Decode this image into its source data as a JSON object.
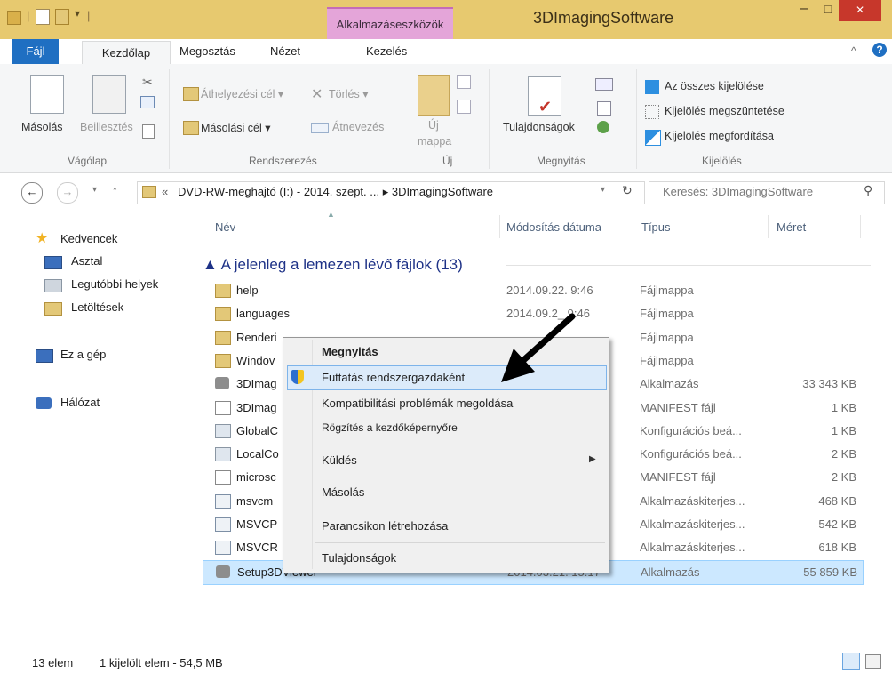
{
  "window": {
    "title": "3DImagingSoftware",
    "context_tab_group": "Alkalmazáseszközök",
    "controls": [
      "–",
      "□",
      "×"
    ]
  },
  "ribbon_tabs": [
    "Fájl",
    "Kezdőlap",
    "Megosztás",
    "Nézet",
    "Kezelés"
  ],
  "ribbon": {
    "clipboard": {
      "copy": "Másolás",
      "paste": "Beillesztés",
      "label": "Vágólap"
    },
    "organize": {
      "move_to": "Áthelyezési cél ▾",
      "copy_to": "Másolási cél ▾",
      "delete": "Törlés ▾",
      "rename": "Átnevezés",
      "label": "Rendszerezés"
    },
    "new": {
      "new_folder_1": "Új",
      "new_folder_2": "mappa",
      "label": "Új"
    },
    "open": {
      "properties": "Tulajdonságok",
      "label": "Megnyitás"
    },
    "select": {
      "select_all": "Az összes kijelölése",
      "select_none": "Kijelölés megszüntetése",
      "invert": "Kijelölés megfordítása",
      "label": "Kijelölés"
    }
  },
  "address": {
    "path_prefix": "«",
    "path": "DVD-RW-meghajtó (I:) - 2014. szept. ...  ▸  3DImagingSoftware",
    "search_placeholder": "Keresés: 3DImagingSoftware"
  },
  "nav": {
    "favorites": "Kedvencek",
    "desktop": "Asztal",
    "recent": "Legutóbbi helyek",
    "downloads": "Letöltések",
    "this_pc": "Ez a gép",
    "network": "Hálózat"
  },
  "columns": {
    "name": "Név",
    "date": "Módosítás dátuma",
    "type": "Típus",
    "size": "Méret"
  },
  "group_header": "▲ A jelenleg a lemezen lévő fájlok (13)",
  "files": [
    {
      "name": "help",
      "date": "2014.09.22. 9:46",
      "type": "Fájlmappa",
      "size": "",
      "icon": "folder"
    },
    {
      "name": "languages",
      "date": "2014.09.2_ 9:46",
      "type": "Fájlmappa",
      "size": "",
      "icon": "folder"
    },
    {
      "name": "Renderi",
      "date": "",
      "type": "Fájlmappa",
      "size": "",
      "icon": "folder"
    },
    {
      "name": "Windov",
      "date": "",
      "type": "Fájlmappa",
      "size": "",
      "icon": "folder"
    },
    {
      "name": "3DImag",
      "date": "",
      "type": "Alkalmazás",
      "size": "33 343 KB",
      "icon": "app"
    },
    {
      "name": "3DImag",
      "date": "",
      "type": "MANIFEST fájl",
      "size": "1 KB",
      "icon": "file"
    },
    {
      "name": "GlobalC",
      "date": "",
      "type": "Konfigurációs beá...",
      "size": "1 KB",
      "icon": "config"
    },
    {
      "name": "LocalCo",
      "date": "",
      "type": "Konfigurációs beá...",
      "size": "2 KB",
      "icon": "config"
    },
    {
      "name": "microsc",
      "date": "",
      "type": "MANIFEST fájl",
      "size": "2 KB",
      "icon": "file"
    },
    {
      "name": "msvcm",
      "date": "",
      "type": "Alkalmazáskiterjes...",
      "size": "468 KB",
      "icon": "dll"
    },
    {
      "name": "MSVCP",
      "date": "",
      "type": "Alkalmazáskiterjes...",
      "size": "542 KB",
      "icon": "dll"
    },
    {
      "name": "MSVCR",
      "date": "",
      "type": "Alkalmazáskiterjes...",
      "size": "618 KB",
      "icon": "dll"
    },
    {
      "name": "Setup3DViewer",
      "date": "2014.03.21. 15:17",
      "type": "Alkalmazás",
      "size": "55 859 KB",
      "icon": "app",
      "selected": true
    }
  ],
  "context_menu": {
    "open": "Megnyitás",
    "run_as_admin": "Futtatás rendszergazdaként",
    "compat": "Kompatibilitási problémák megoldása",
    "pin_start": "Rögzítés a kezdőképernyőre",
    "send_to": "Küldés",
    "copy": "Másolás",
    "create_shortcut": "Parancsikon létrehozása",
    "properties": "Tulajdonságok"
  },
  "status": {
    "count": "13 elem",
    "selected": "1 kijelölt elem - 54,5 MB"
  },
  "colors": {
    "title_bar": "#e7c96f",
    "context_tab": "#e4a5d9",
    "file_tab": "#1f6fc2",
    "close_button": "#c7372b",
    "selection": "#cce8ff",
    "menu_highlight": "#dcebfa"
  }
}
